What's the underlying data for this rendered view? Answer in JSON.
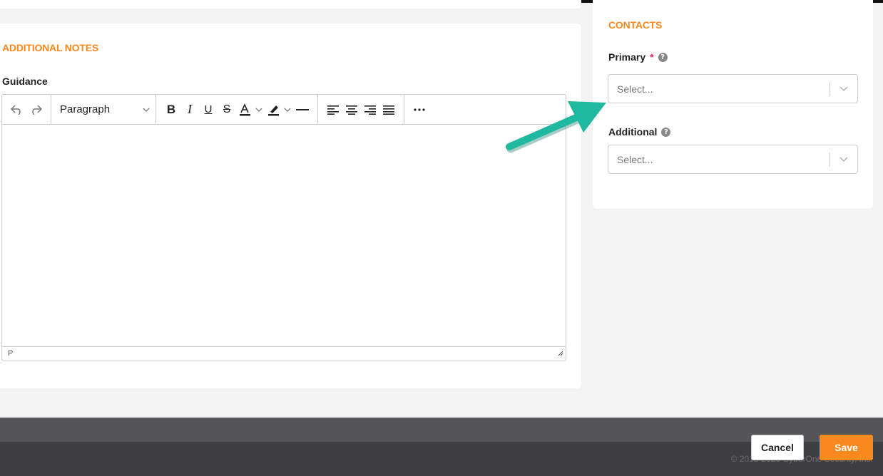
{
  "notes": {
    "section_title": "ADDITIONAL NOTES",
    "guidance_label": "Guidance",
    "editor": {
      "block_format": "Paragraph",
      "status_path": "P",
      "content": ""
    }
  },
  "contacts": {
    "section_title": "CONTACTS",
    "primary_label": "Primary",
    "primary_required_marker": "*",
    "primary_placeholder": "Select...",
    "additional_label": "Additional",
    "additional_placeholder": "Select..."
  },
  "footer": {
    "copyright": "© 2015-2020 CyberOne Security, Inc.",
    "cancel_label": "Cancel",
    "save_label": "Save"
  },
  "colors": {
    "accent_orange": "#f7891f",
    "annotation_teal": "#1fb8a0",
    "required_red": "#e0245e"
  },
  "icons": {
    "toolbar": [
      "undo-icon",
      "redo-icon",
      "bold-icon",
      "italic-icon",
      "underline-icon",
      "strikethrough-icon",
      "text-color-icon",
      "highlight-icon",
      "horizontal-rule-icon",
      "align-left-icon",
      "align-center-icon",
      "align-right-icon",
      "justify-icon",
      "more-icon"
    ],
    "help": "question-circle-icon",
    "dropdown": "chevron-down-icon"
  }
}
